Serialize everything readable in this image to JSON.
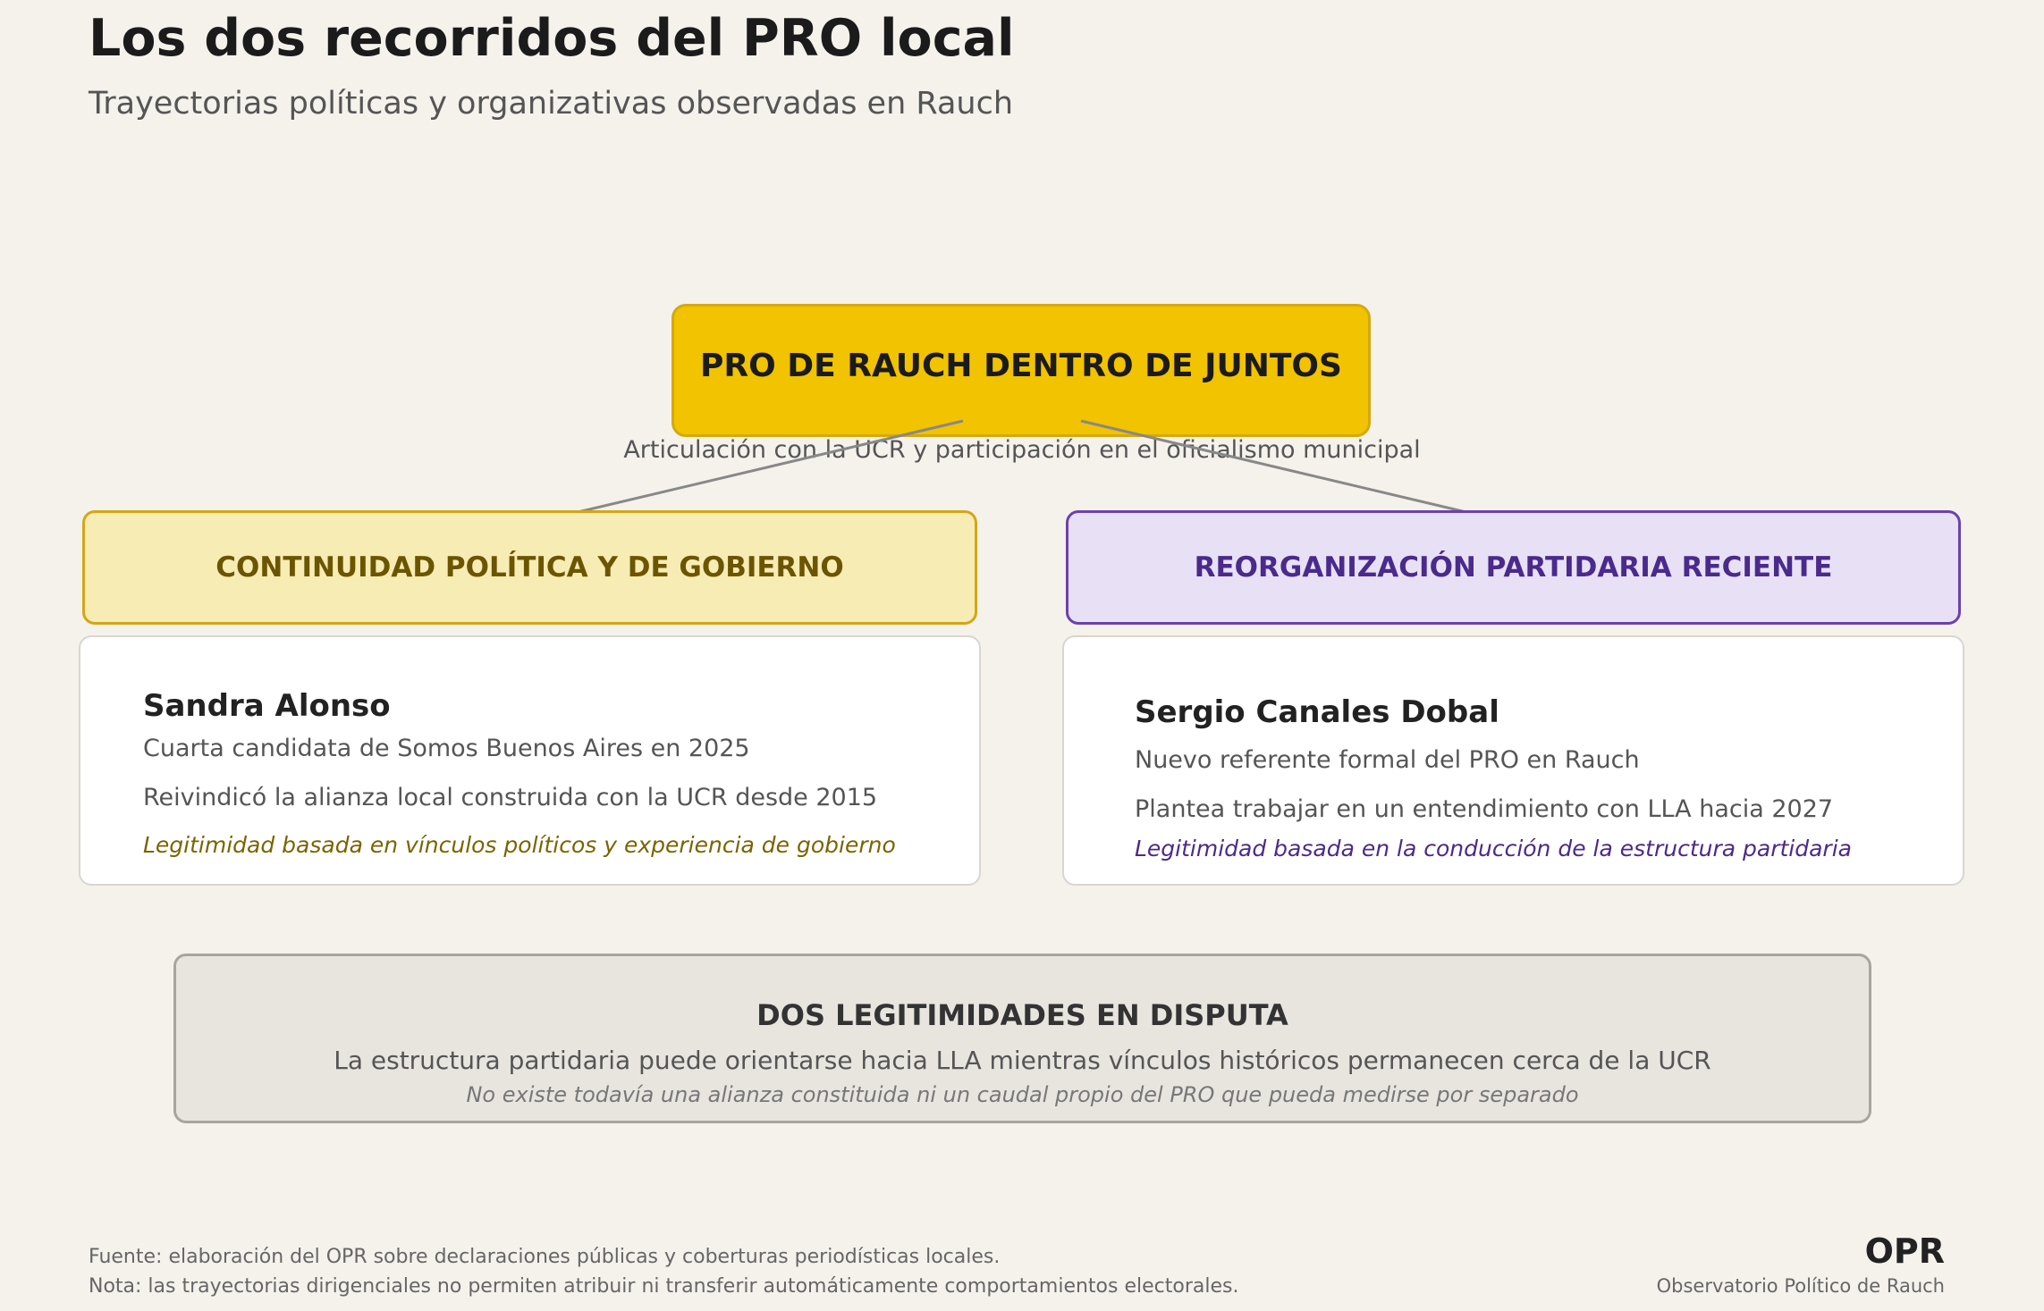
{
  "header": {
    "title": "Los dos recorridos del PRO local",
    "subtitle": "Trayectorias políticas y organizativas observadas en Rauch"
  },
  "root": {
    "label": "PRO DE RAUCH DENTRO DE JUNTOS",
    "caption": "Articulación con la UCR y participación en el oficialismo municipal"
  },
  "branches": [
    {
      "label": "CONTINUIDAD POLÍTICA Y DE GOBIERNO",
      "person": "Sandra Alonso",
      "lines": [
        "Cuarta candidata de Somos Buenos Aires en 2025",
        "Reivindicó la alianza local construida con la UCR desde 2015"
      ],
      "legitimacy": "Legitimidad basada en vínculos políticos y experiencia de gobierno",
      "color": "#f8ecb5",
      "accent": "#6b5500"
    },
    {
      "label": "REORGANIZACIÓN PARTIDARIA RECIENTE",
      "person": "Sergio Canales Dobal",
      "lines": [
        "Nuevo referente formal del PRO en Rauch",
        "Plantea trabajar en un entendimiento con LLA hacia 2027"
      ],
      "legitimacy": "Legitimidad basada en la conducción de la estructura partidaria",
      "color": "#e8e1f5",
      "accent": "#4a2a8c"
    }
  ],
  "summary": {
    "title": "DOS LEGITIMIDADES EN DISPUTA",
    "text": "La estructura partidaria puede orientarse hacia LLA mientras vínculos históricos permanecen cerca de la UCR",
    "note": "No existe todavía una alianza constituida ni un caudal propio del PRO que pueda medirse por separado"
  },
  "footer": {
    "source": "Fuente: elaboración del OPR sobre declaraciones públicas y coberturas periodísticas locales.",
    "note": "Nota: las trayectorias dirigenciales no permiten atribuir ni transferir automáticamente comportamientos electorales.",
    "brand": "OPR",
    "brand_full": "Observatorio Político de Rauch"
  }
}
